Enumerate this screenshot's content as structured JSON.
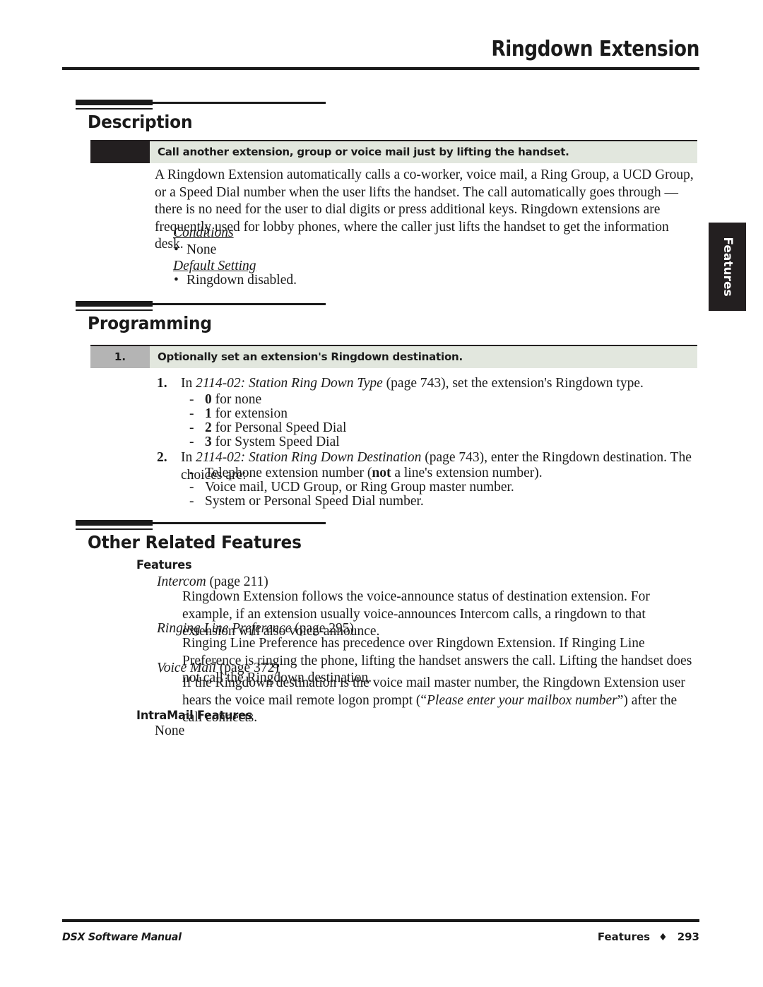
{
  "header": {
    "title": "Ringdown Extension"
  },
  "side_tab": {
    "label": "Features"
  },
  "sections": {
    "description": {
      "title": "Description",
      "callout": "Call another extension, group or voice mail just by lifting the handset.",
      "paragraph": "A Ringdown Extension automatically calls a co-worker, voice mail, a Ring Group, a UCD Group, or a Speed Dial number when the user lifts the handset. The call automatically goes through — there is no need for the user to dial digits or press additional keys. Ringdown extensions are frequently used for lobby phones, where the caller just lifts the handset to get the information desk.",
      "conditions_label": "Conditions",
      "conditions_bullet": "None",
      "default_label": "Default Setting",
      "default_bullet": "Ringdown disabled."
    },
    "programming": {
      "title": "Programming",
      "step_number": "1.",
      "callout": "Optionally set an extension's Ringdown destination.",
      "items": [
        {
          "num": "1.",
          "pre": "In ",
          "ref": "2114-02: Station Ring Down Type",
          "post": " (page 743), set the extension's Ringdown type.",
          "dashes": [
            {
              "bold": "0",
              "rest": " for none"
            },
            {
              "bold": "1",
              "rest": " for extension"
            },
            {
              "bold": "2",
              "rest": " for Personal Speed Dial"
            },
            {
              "bold": "3",
              "rest": " for System Speed Dial"
            }
          ]
        },
        {
          "num": "2.",
          "pre": "In ",
          "ref": "2114-02: Station Ring Down Destination",
          "post": " (page 743), enter the Ringdown destination. The choices are:",
          "dashes": [
            {
              "pre": "Telephone extension number (",
              "em": "not",
              "post": " a line's extension number)."
            },
            {
              "pre": "Voice mail, UCD Group, or Ring Group master number."
            },
            {
              "pre": "System or Personal Speed Dial number."
            }
          ]
        }
      ]
    },
    "other_related": {
      "title": "Other Related Features",
      "features_heading": "Features",
      "entries": [
        {
          "name": "Intercom",
          "page": "(page 211)",
          "body": "Ringdown Extension follows the voice-announce status of destination extension. For example, if an extension usually voice-announces Intercom calls, a ringdown to that extension will also voice-announce."
        },
        {
          "name": "Ringing Line Preference",
          "page": "(page 295)",
          "body": "Ringing Line Preference has precedence over Ringdown Extension. If Ringing Line Preference is ringing the phone, lifting the handset answers the call. Lifting the handset does not call the Ringdown destination."
        },
        {
          "name": "Voice Mail",
          "page": "(page 372)",
          "body_pre": "If the Ringdown destination is the voice mail master number, the Ringdown Extension user hears the voice mail remote logon prompt (“",
          "body_em": "Please enter your mailbox number",
          "body_post": "”) after the call connects."
        }
      ],
      "intramail_heading": "IntraMail Features",
      "intramail_body": "None"
    }
  },
  "footer": {
    "manual": "DSX Software Manual",
    "section": "Features",
    "diamond": "♦",
    "page_number": "293"
  },
  "colors": {
    "ink": "#1a1a1a",
    "callout_bg": "#e2e7de",
    "swatch": "#231f20",
    "numcell": "#b4b4b4"
  }
}
